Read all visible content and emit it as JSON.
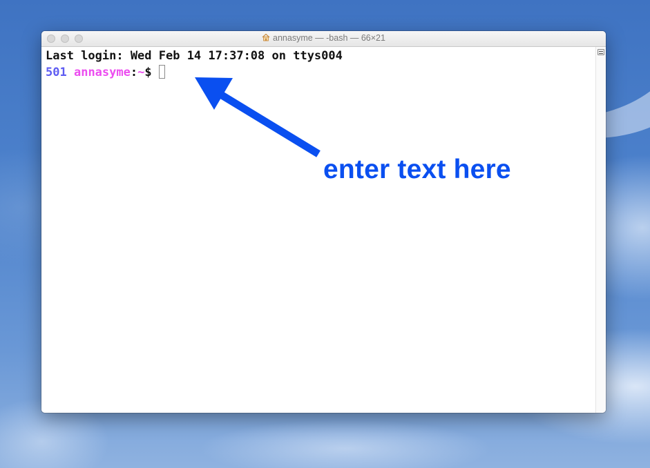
{
  "window": {
    "title": "annasyme — -bash — 66×21",
    "title_icon": "home-icon"
  },
  "terminal": {
    "last_login": "Last login: Wed Feb 14 17:37:08 on ttys004",
    "prompt": {
      "uid": "501",
      "user": "annasyme",
      "colon": ":",
      "path": "~",
      "symbol": "$"
    }
  },
  "annotation": {
    "text": "enter text here"
  },
  "colors": {
    "uid": "#5e5cf2",
    "user": "#ec4df0",
    "annotation": "#0a4ff0",
    "desktop": "#4d82cc"
  }
}
